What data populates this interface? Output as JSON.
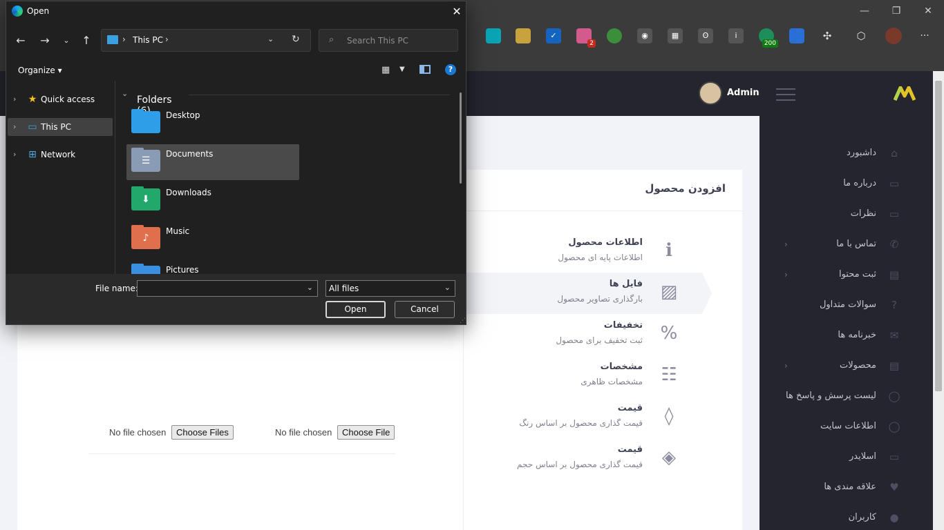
{
  "browser": {
    "controls": {
      "minimize": "—",
      "restore": "❐",
      "close": "✕"
    },
    "extensions": [
      {
        "icon": "teal-ext-icon",
        "color": "#0aa5b5"
      },
      {
        "icon": "colorful-ext-icon",
        "color": "#c7a23d"
      },
      {
        "icon": "check-ext-icon",
        "color": "#1565c0"
      },
      {
        "icon": "pink-ext-icon",
        "color": "#d35a8d",
        "badge": "2"
      },
      {
        "icon": "globe-ext-icon",
        "color": "#3b8f3b"
      },
      {
        "icon": "camera-ext-icon",
        "color": "#7a7a7a"
      },
      {
        "icon": "calendar-ext-icon",
        "color": "#7a7a7a"
      },
      {
        "icon": "translate-ext-icon",
        "color": "#7a7a7a"
      },
      {
        "icon": "info-ext-icon",
        "color": "#7a7a7a"
      },
      {
        "icon": "sync-ext-icon",
        "color": "#1e8f5a",
        "badge": "200"
      },
      {
        "icon": "blue-ext-icon",
        "color": "#2a6fd6"
      },
      {
        "icon": "puzzle-ext-icon",
        "color": "#7a7a7a"
      },
      {
        "icon": "shield-ext-icon",
        "color": "#7a7a7a"
      }
    ],
    "more": "···"
  },
  "page": {
    "admin_name": "Admin",
    "card_title": "افزودن محصول",
    "sidebar": [
      {
        "label": "داشبورد",
        "chevron": false
      },
      {
        "label": "درباره ما",
        "chevron": false
      },
      {
        "label": "نظرات",
        "chevron": false
      },
      {
        "label": "تماس با ما",
        "chevron": true
      },
      {
        "label": "ثبت محتوا",
        "chevron": true
      },
      {
        "label": "سوالات متداول",
        "chevron": false
      },
      {
        "label": "خبرنامه ها",
        "chevron": false
      },
      {
        "label": "محصولات",
        "chevron": true
      },
      {
        "label": "لیست پرسش و پاسخ ها",
        "chevron": false
      },
      {
        "label": "اطلاعات سایت",
        "chevron": false
      },
      {
        "label": "اسلایدر",
        "chevron": false
      },
      {
        "label": "علاقه مندی ها",
        "chevron": false
      },
      {
        "label": "کاربران",
        "chevron": false
      }
    ],
    "steps": [
      {
        "title": "اطلاعات محصول",
        "desc": "اطلاعات پایه ای محصول",
        "icon": "ℹ"
      },
      {
        "title": "فایل ها",
        "desc": "بارگذاری تصاویر محصول",
        "icon": "▨"
      },
      {
        "title": "تخفیفات",
        "desc": "ثبت تخفیف برای محصول",
        "icon": "%"
      },
      {
        "title": "مشخصات",
        "desc": "مشخصات ظاهری",
        "icon": "☷"
      },
      {
        "title": "قیمت",
        "desc": "قیمت گذاری محصول بر اساس رنگ",
        "icon": "◊"
      },
      {
        "title": "قیمت",
        "desc": "قیمت گذاری محصول بر اساس حجم",
        "icon": "◈"
      }
    ],
    "file_inputs": [
      {
        "status": "No file chosen",
        "button": "Choose Files"
      },
      {
        "status": "No file chosen",
        "button": "Choose File"
      }
    ]
  },
  "dialog": {
    "title": "Open",
    "close": "✕",
    "address": "This PC",
    "search_placeholder": "Search This PC",
    "organize": "Organize ▾",
    "nav": [
      {
        "label": "Quick access",
        "icon": "★",
        "color": "#f5c518"
      },
      {
        "label": "This PC",
        "icon": "▭",
        "color": "#3aa0e0",
        "selected": true
      },
      {
        "label": "Network",
        "icon": "⊞",
        "color": "#4fa8e0"
      }
    ],
    "group": "Folders (6)",
    "folders": [
      {
        "label": "Desktop",
        "color": "#2f9ee8",
        "glyph": ""
      },
      {
        "label": "Documents",
        "color": "#8a9bb5",
        "glyph": "☰",
        "selected": true
      },
      {
        "label": "Downloads",
        "color": "#22a86a",
        "glyph": "⬇"
      },
      {
        "label": "Music",
        "color": "#e0704d",
        "glyph": "♪"
      },
      {
        "label": "Pictures",
        "color": "#3a8fe0",
        "glyph": ""
      }
    ],
    "file_name_label": "File name:",
    "file_name_value": "",
    "file_type": "All files",
    "open": "Open",
    "cancel": "Cancel"
  }
}
